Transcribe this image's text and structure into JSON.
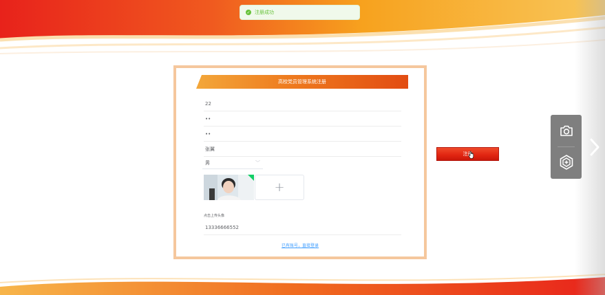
{
  "toast": {
    "message": "注册成功",
    "icon": "check-circle-icon"
  },
  "form": {
    "title": "高校党员管理系统注册",
    "fields": {
      "account": "22",
      "password": "••",
      "confirm_password": "••",
      "name": "张翼",
      "gender_selected": "男",
      "upload_hint": "点击上传头像",
      "phone": "13336666552"
    },
    "upload_add_symbol": "+",
    "login_link": "已有账号，直接登录"
  },
  "register_button": {
    "label": "注册"
  },
  "colors": {
    "accent_orange": "#ee7a1e",
    "accent_red": "#e02410",
    "panel_border": "#f5c79d",
    "success": "#67c23a"
  },
  "toolbar": {
    "icons": [
      "camera-icon",
      "hex-add-icon"
    ],
    "next": "chevron-right-icon"
  }
}
